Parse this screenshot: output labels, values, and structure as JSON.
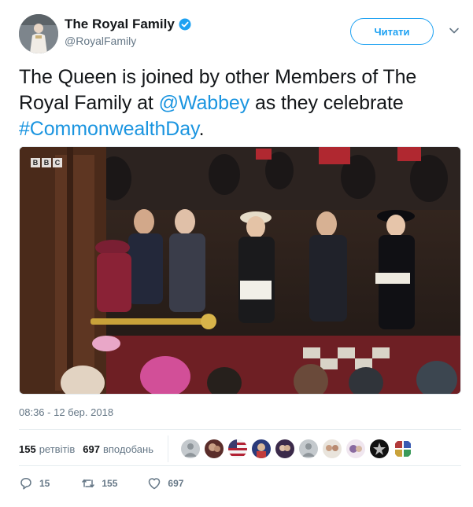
{
  "account": {
    "display_name": "The Royal Family",
    "handle": "@RoyalFamily",
    "avatar_icon": "avatar-queen",
    "verified_icon": "verified-badge-icon"
  },
  "follow_button": {
    "label": "Читати"
  },
  "menu_icon": "chevron-down-icon",
  "tweet": {
    "text_before": "The Queen is joined by other Members of The Royal Family at ",
    "mention": "@Wabbey",
    "text_middle": " as they celebrate ",
    "hashtag": "#CommonwealthDay",
    "text_after": "."
  },
  "media": {
    "watermark": [
      "B",
      "B",
      "C"
    ]
  },
  "timestamp": "08:36 - 12 бер. 2018",
  "stats": {
    "retweets_count": "155",
    "retweets_label": "ретвітів",
    "likes_count": "697",
    "likes_label": "вподобань"
  },
  "actions": {
    "reply_count": "15",
    "retweet_count": "155",
    "like_count": "697"
  },
  "colors": {
    "link": "#1b95e0",
    "follow": "#1da1f2",
    "muted": "#657786",
    "border": "#e6ecf0"
  }
}
